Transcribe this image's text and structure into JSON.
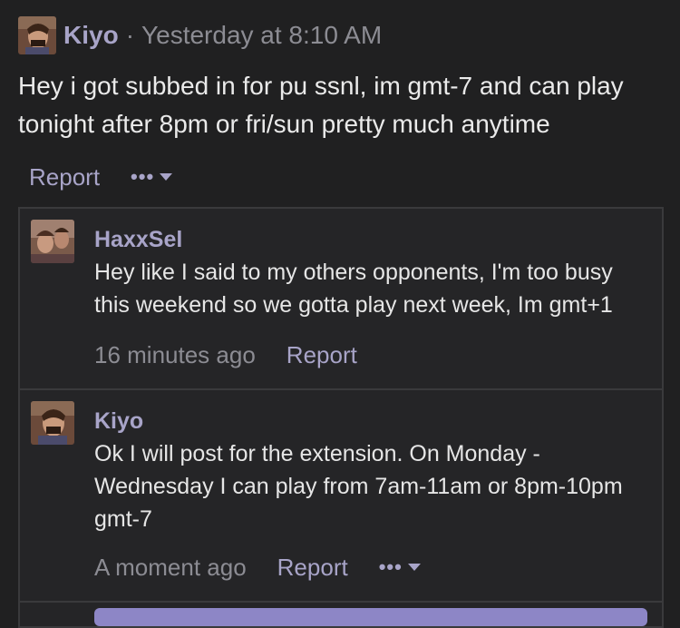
{
  "post": {
    "author": "Kiyo",
    "separator": "·",
    "time": "Yesterday at 8:10 AM",
    "text": "Hey i got subbed in for pu ssnl, im gmt-7 and can play tonight after 8pm or fri/sun pretty much anytime",
    "report_label": "Report",
    "more_label": "•••"
  },
  "replies": [
    {
      "author": "HaxxSel",
      "text": "Hey like I said to my others opponents, I'm too busy this weekend so we gotta play next week, Im gmt+1",
      "time": "16 minutes ago",
      "report_label": "Report"
    },
    {
      "author": "Kiyo",
      "text": "Ok I will post for the extension. On Monday - Wednesday I can play from 7am-11am or 8pm-10pm gmt-7",
      "time": "A moment ago",
      "report_label": "Report",
      "more_label": "•••"
    }
  ],
  "colors": {
    "background": "#202021",
    "accent": "#a8a4c8",
    "muted": "#8c8c93",
    "border": "#3a3a3c"
  }
}
